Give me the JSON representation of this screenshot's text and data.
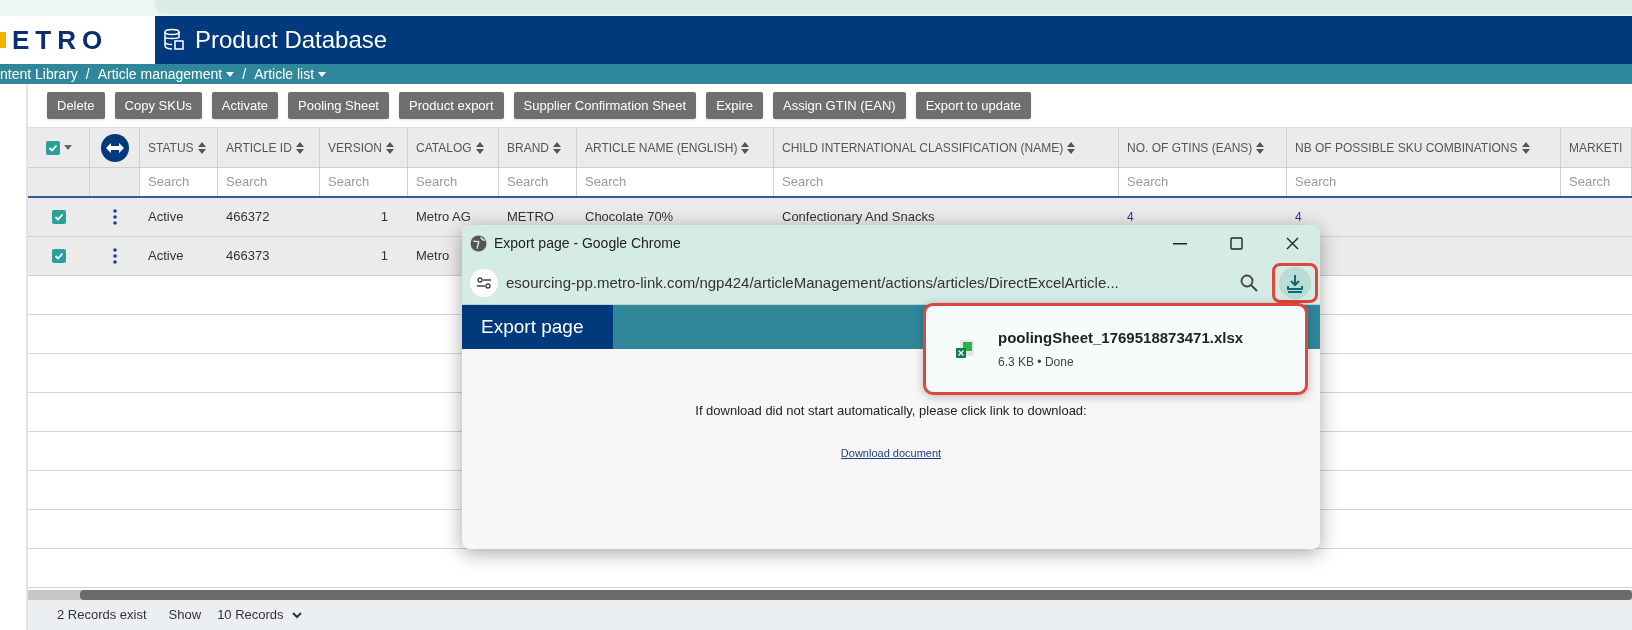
{
  "logo": {
    "text": "ETRO"
  },
  "header": {
    "title": "Product Database"
  },
  "breadcrumb": [
    {
      "label": "ntent Library",
      "dropdown": false
    },
    {
      "separator": "/",
      "label": "Article management",
      "dropdown": true
    },
    {
      "separator": "/",
      "label": "Article list",
      "dropdown": true
    }
  ],
  "toolbar": [
    "Delete",
    "Copy SKUs",
    "Activate",
    "Pooling Sheet",
    "Product export",
    "Supplier Confirmation Sheet",
    "Expire",
    "Assign GTIN (EAN)",
    "Export to update"
  ],
  "table": {
    "select_all": {
      "checked": true
    },
    "columns": [
      {
        "label": "STATUS",
        "kind": "text",
        "sortable": true,
        "placeholder": "Search"
      },
      {
        "label": "ARTICLE ID",
        "kind": "text",
        "sortable": true,
        "placeholder": "Search"
      },
      {
        "label": "VERSION",
        "kind": "number",
        "sortable": true,
        "placeholder": "Search"
      },
      {
        "label": "CATALOG",
        "kind": "text",
        "sortable": true,
        "placeholder": "Search"
      },
      {
        "label": "BRAND",
        "kind": "text",
        "sortable": true,
        "placeholder": "Search"
      },
      {
        "label": "ARTICLE NAME (ENGLISH)",
        "kind": "text",
        "sortable": true,
        "placeholder": "Search"
      },
      {
        "label": "CHILD INTERNATIONAL CLASSIFICATION (NAME)",
        "kind": "text",
        "sortable": true,
        "placeholder": "Search"
      },
      {
        "label": "NO. OF GTINS (EANS)",
        "kind": "count",
        "sortable": true,
        "placeholder": "Search"
      },
      {
        "label": "NB OF POSSIBLE SKU COMBINATIONS",
        "kind": "count",
        "sortable": true,
        "placeholder": "Search"
      },
      {
        "label": "MARKETI",
        "sortable": false,
        "placeholder": "Search"
      }
    ],
    "rows": [
      {
        "checked": true,
        "cells": [
          "Active",
          "466372",
          "1",
          "Metro AG",
          "METRO",
          "Chocolate 70%",
          "Confectionary And Snacks",
          "4",
          "4"
        ]
      },
      {
        "checked": true,
        "cells": [
          "Active",
          "466373",
          "1",
          "Metro"
        ]
      }
    ]
  },
  "footer": {
    "records": "2 Records exist",
    "show_label": "Show",
    "page_size": "10 Records"
  },
  "dialog": {
    "title": "Export page - Google Chrome",
    "url": "esourcing-pp.metro-link.com/ngp424/articleManagement/actions/articles/DirectExcelArticle...",
    "download_button": {
      "highlighted": true
    },
    "page_title": "Export page",
    "message": "If download did not start automatically, please click link to download:",
    "link": "Download document",
    "download": {
      "highlighted": true,
      "filename": "poolingSheet_1769518873471.xlsx",
      "status": "6.3 KB • Done"
    }
  }
}
